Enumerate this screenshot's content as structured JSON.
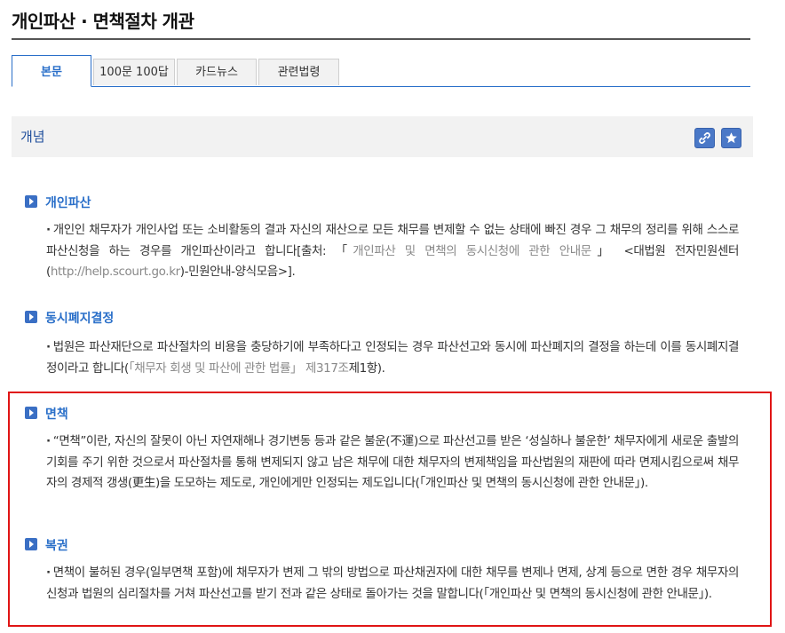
{
  "page": {
    "title": "개인파산 · 면책절차 개관"
  },
  "tabs": [
    {
      "label": "본문"
    },
    {
      "label": "100문 100답"
    },
    {
      "label": "카드뉴스"
    },
    {
      "label": "관련법령"
    }
  ],
  "section": {
    "title": "개념",
    "link_icon": "link-icon",
    "star_icon": "star-icon",
    "accent_color": "#4a78c7"
  },
  "terms": [
    {
      "name": "개인파산",
      "body": {
        "part1": "개인인 채무자가 개인사업 또는 소비활동의 결과 자신의 재산으로 모든 채무를 변제할 수 없는 상태에 빠진 경우 그 채무의 정리를 위해 스스로 파산신청을 하는 경우를 개인파산이라고 합니다[출처: 「",
        "ref1": "개인파산 및 면책의 동시신청에 관한 안내문",
        "part2": "」 <대법원 전자민원센터(",
        "url": "http://help.scourt.go.kr",
        "part3": ")-민원안내-양식모음>]."
      }
    },
    {
      "name": "동시폐지결정",
      "body": {
        "part1": "법원은 파산재단으로 파산절차의 비용을 충당하기에 부족하다고 인정되는 경우 파산선고와 동시에 파산폐지의 결정을 하는데 이를 동시폐지결정이라고 합니다(",
        "ref1": "「채무자 회생 및 파산에 관한 법률」 제317조",
        "part2": "제1항)."
      }
    },
    {
      "name": "면책",
      "body": "“면책”이란, 자신의 잘못이 아닌 자연재해나 경기변동 등과 같은 불운(不運)으로 파산선고를 받은 ‘성실하나 불운한’ 채무자에게 새로운 출발의 기회를 주기 위한 것으로서 파산절차를 통해 변제되지 않고 남은 채무에 대한 채무자의 변제책임을 파산법원의 재판에 따라 면제시킴으로써 채무자의 경제적 갱생(更生)을 도모하는 제도로, 개인에게만 인정되는 제도입니다(「개인파산 및 면책의 동시신청에 관한 안내문」)."
    },
    {
      "name": "복권",
      "body": "면책이 불허된 경우(일부면책 포함)에 채무자가 변제 그 밖의 방법으로 파산채권자에 대한 채무를 변제나 면제, 상계 등으로 면한 경우 채무자의 신청과 법원의 심리절차를 거쳐 파산선고를 받기 전과 같은 상태로 돌아가는 것을 말합니다(「개인파산 및 면책의 동시신청에 관한 안내문」)."
    }
  ],
  "colors": {
    "tab_active": "#2a6fc9",
    "term_title": "#2a6fc9",
    "highlight_border": "#e01515",
    "muted_text": "#888888"
  }
}
